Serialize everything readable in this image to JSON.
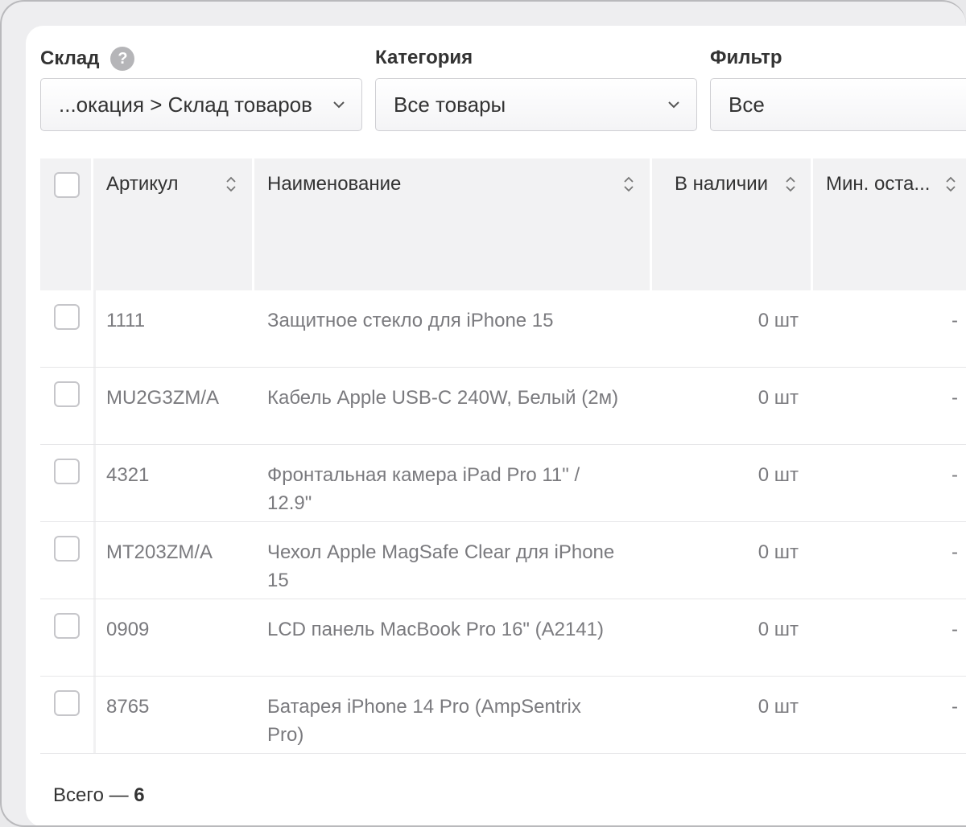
{
  "filters": {
    "warehouse": {
      "label": "Склад",
      "help_icon": "?",
      "value": "...окация > Склад товаров"
    },
    "category": {
      "label": "Категория",
      "value": "Все товары"
    },
    "filter": {
      "label": "Фильтр",
      "value": "Все"
    }
  },
  "table": {
    "columns": {
      "sku": "Артикул",
      "name": "Наименование",
      "in_stock": "В наличии",
      "min_stock": "Мин. оста..."
    },
    "rows": [
      {
        "sku": "1111",
        "name": "Защитное стекло для iPhone 15",
        "in_stock": "0 шт",
        "min_stock": "-"
      },
      {
        "sku": "MU2G3ZM/A",
        "name": "Кабель Apple USB-C 240W, Белый (2м)",
        "in_stock": "0 шт",
        "min_stock": "-"
      },
      {
        "sku": "4321",
        "name": "Фронтальная камера iPad Pro 11\" / 12.9\"",
        "in_stock": "0 шт",
        "min_stock": "-"
      },
      {
        "sku": "MT203ZM/A",
        "name": "Чехол Apple MagSafe Clear для iPhone 15",
        "in_stock": "0 шт",
        "min_stock": "-"
      },
      {
        "sku": "0909",
        "name": "LCD панель MacBook Pro 16\" (A2141)",
        "in_stock": "0 шт",
        "min_stock": "-"
      },
      {
        "sku": "8765",
        "name": "Батарея iPhone 14 Pro (AmpSentrix Pro)",
        "in_stock": "0 шт",
        "min_stock": "-"
      }
    ]
  },
  "footer": {
    "total_label": "Всего —",
    "total_count": "6"
  }
}
